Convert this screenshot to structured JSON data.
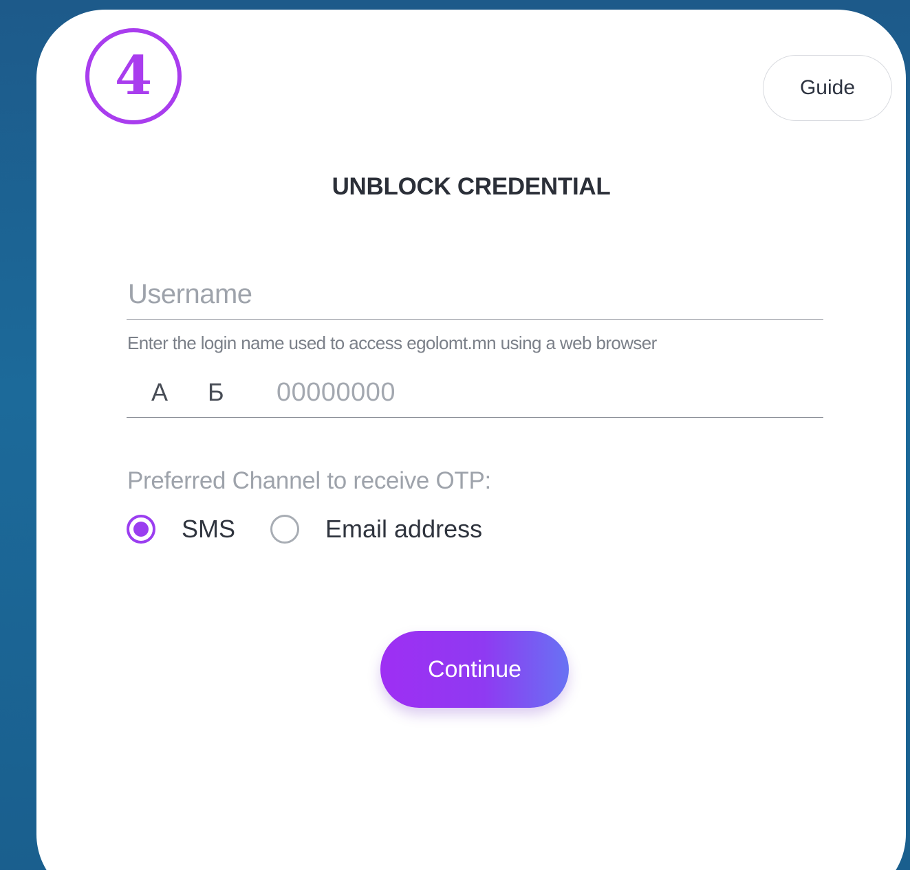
{
  "step": {
    "number": "4",
    "color": "#a93dee"
  },
  "header": {
    "guide_label": "Guide"
  },
  "form": {
    "title": "UNBLOCK CREDENTIAL",
    "username": {
      "placeholder": "Username",
      "helper": "Enter the login name used to access egolomt.mn using a web browser"
    },
    "register": {
      "letter1": "А",
      "letter2": "Б",
      "number_placeholder": "00000000"
    },
    "otp": {
      "label": "Preferred Channel to receive OTP:",
      "options": [
        {
          "label": "SMS",
          "selected": true
        },
        {
          "label": "Email address",
          "selected": false
        }
      ]
    },
    "continue_label": "Continue"
  },
  "colors": {
    "accent": "#9b3ef0",
    "button_gradient_start": "#9e2ff3",
    "button_gradient_end": "#6872f3",
    "background": "#1c6a9a"
  }
}
